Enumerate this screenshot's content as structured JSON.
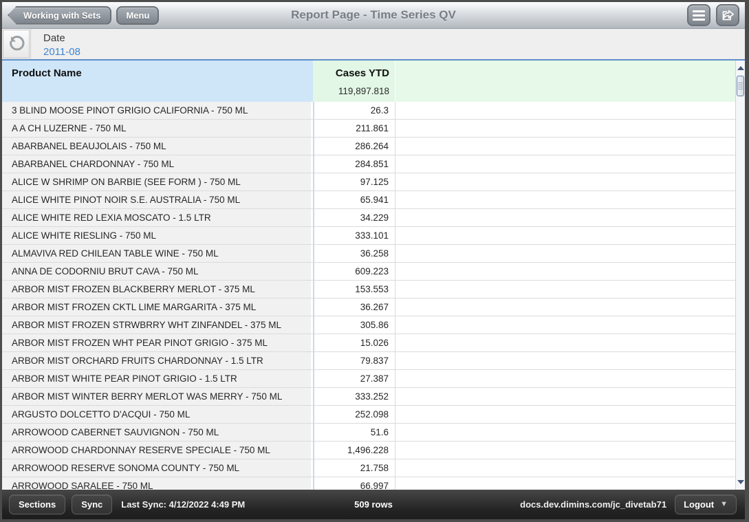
{
  "header": {
    "back_button": "Working with Sets",
    "menu_button": "Menu",
    "title": "Report Page - Time Series QV",
    "icons": {
      "menu": "hamburger-icon",
      "share": "share-export-icon"
    }
  },
  "filter": {
    "label": "Date",
    "value": "2011-08",
    "icon": "refresh-reset-icon"
  },
  "table": {
    "columns": [
      {
        "label": "Product Name"
      },
      {
        "label": "Cases YTD",
        "total": "119,897.818"
      }
    ],
    "rows": [
      {
        "name": "3 BLIND MOOSE PINOT GRIGIO CALIFORNIA - 750 ML",
        "value": "26.3"
      },
      {
        "name": "A A CH LUZERNE - 750 ML",
        "value": "211.861"
      },
      {
        "name": "ABARBANEL BEAUJOLAIS - 750 ML",
        "value": "286.264"
      },
      {
        "name": "ABARBANEL CHARDONNAY - 750 ML",
        "value": "284.851"
      },
      {
        "name": "ALICE W SHRIMP ON BARBIE (SEE FORM ) - 750 ML",
        "value": "97.125"
      },
      {
        "name": "ALICE WHITE PINOT NOIR S.E. AUSTRALIA - 750 ML",
        "value": "65.941"
      },
      {
        "name": "ALICE WHITE RED LEXIA MOSCATO - 1.5 LTR",
        "value": "34.229"
      },
      {
        "name": "ALICE WHITE RIESLING - 750 ML",
        "value": "333.101"
      },
      {
        "name": "ALMAVIVA RED CHILEAN TABLE WINE - 750 ML",
        "value": "36.258"
      },
      {
        "name": "ANNA DE CODORNIU BRUT CAVA - 750 ML",
        "value": "609.223"
      },
      {
        "name": "ARBOR MIST FROZEN BLACKBERRY MERLOT - 375 ML",
        "value": "153.553"
      },
      {
        "name": "ARBOR MIST FROZEN CKTL LIME MARGARITA - 375 ML",
        "value": "36.267"
      },
      {
        "name": "ARBOR MIST FROZEN STRWBRRY WHT ZINFANDEL - 375 ML",
        "value": "305.86"
      },
      {
        "name": "ARBOR MIST FROZEN WHT PEAR PINOT GRIGIO - 375 ML",
        "value": "15.026"
      },
      {
        "name": "ARBOR MIST ORCHARD FRUITS CHARDONNAY - 1.5 LTR",
        "value": "79.837"
      },
      {
        "name": "ARBOR MIST WHITE PEAR PINOT GRIGIO - 1.5 LTR",
        "value": "27.387"
      },
      {
        "name": "ARBOR MIST WINTER BERRY MERLOT WAS MERRY - 750 ML",
        "value": "333.252"
      },
      {
        "name": "ARGUSTO DOLCETTO D'ACQUI - 750 ML",
        "value": "252.098"
      },
      {
        "name": "ARROWOOD CABERNET SAUVIGNON - 750 ML",
        "value": "51.6"
      },
      {
        "name": "ARROWOOD CHARDONNAY RESERVE SPECIALE - 750 ML",
        "value": "1,496.228"
      },
      {
        "name": "ARROWOOD RESERVE SONOMA COUNTY - 750 ML",
        "value": "21.758"
      },
      {
        "name": "ARROWOOD SARALEE - 750 ML",
        "value": "66.997"
      }
    ]
  },
  "footer": {
    "sections_button": "Sections",
    "sync_button": "Sync",
    "last_sync": "Last Sync: 4/12/2022 4:49 PM",
    "row_count": "509 rows",
    "server": "docs.dev.dimins.com/jc_divetab71",
    "logout_button": "Logout"
  },
  "colors": {
    "accent_blue_link": "#3f84d1",
    "filter_divider_blue": "#5d8fc9",
    "product_header_bg": "#cfe6f8",
    "cases_header_bg": "#e2f7e5",
    "row_name_bg": "#f1f1f2",
    "topbar_button_gray": "#848a92",
    "bottombar_bg": "#2a2a2a"
  }
}
